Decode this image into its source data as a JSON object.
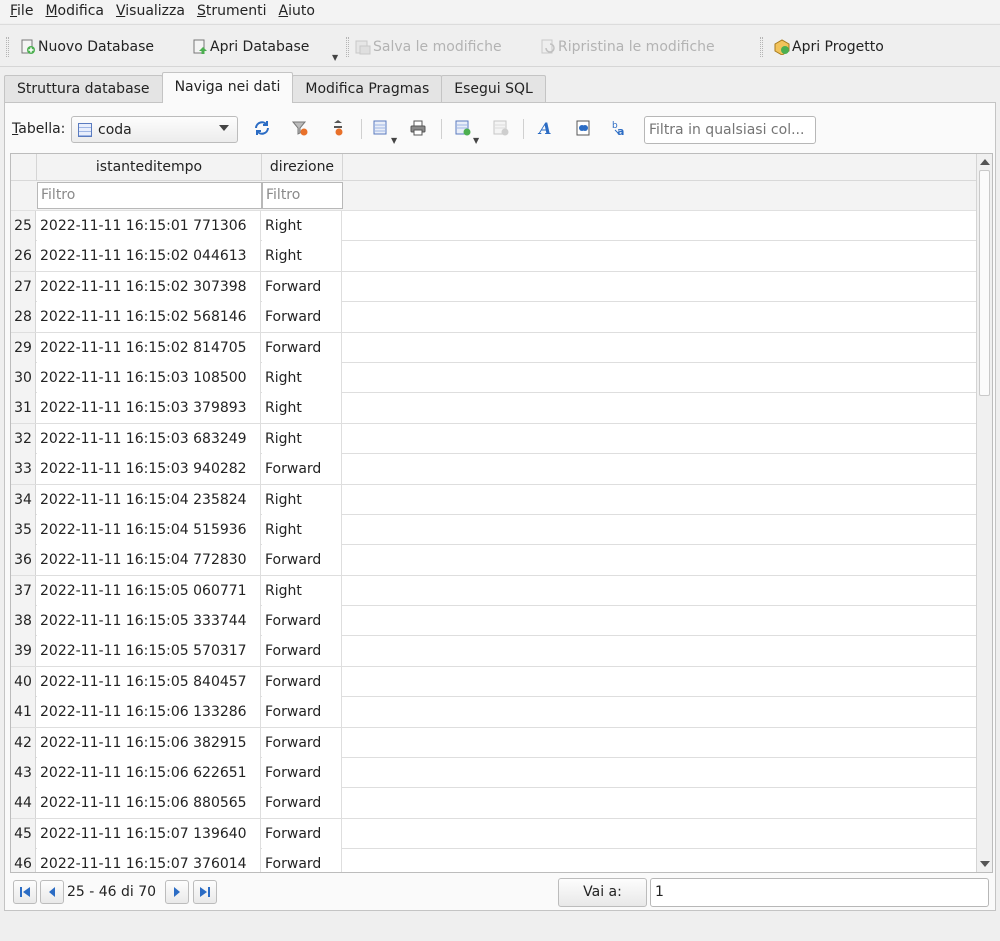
{
  "menu": [
    {
      "u": "F",
      "rest": "ile"
    },
    {
      "u": "M",
      "rest": "odifica"
    },
    {
      "u": "V",
      "rest": "isualizza"
    },
    {
      "u": "S",
      "rest": "trumenti"
    },
    {
      "u": "A",
      "rest": "iuto"
    }
  ],
  "toolbar": {
    "new_db": "Nuovo Database",
    "open_db": "Apri Database",
    "save_changes": "Salva le modifiche",
    "revert_changes": "Ripristina le modifiche",
    "open_project": "Apri Progetto"
  },
  "tabs": [
    "Struttura database",
    "Naviga nei dati",
    "Modifica Pragmas",
    "Esegui SQL"
  ],
  "active_tab": 1,
  "table_toolbar": {
    "label_u": "T",
    "label_rest": "abella:",
    "table_name": "coda",
    "filter_all_placeholder": "Filtra in qualsiasi col..."
  },
  "grid": {
    "columns": [
      "istanteditempo",
      "direzione"
    ],
    "filter_placeholder": "Filtro",
    "rows": [
      {
        "n": "25",
        "t": "2022-11-11 16:15:01 771306",
        "d": "Right"
      },
      {
        "n": "26",
        "t": "2022-11-11 16:15:02 044613",
        "d": "Right"
      },
      {
        "n": "27",
        "t": "2022-11-11 16:15:02 307398",
        "d": "Forward"
      },
      {
        "n": "28",
        "t": "2022-11-11 16:15:02 568146",
        "d": "Forward"
      },
      {
        "n": "29",
        "t": "2022-11-11 16:15:02 814705",
        "d": "Forward"
      },
      {
        "n": "30",
        "t": "2022-11-11 16:15:03 108500",
        "d": "Right"
      },
      {
        "n": "31",
        "t": "2022-11-11 16:15:03 379893",
        "d": "Right"
      },
      {
        "n": "32",
        "t": "2022-11-11 16:15:03 683249",
        "d": "Right"
      },
      {
        "n": "33",
        "t": "2022-11-11 16:15:03 940282",
        "d": "Forward"
      },
      {
        "n": "34",
        "t": "2022-11-11 16:15:04 235824",
        "d": "Right"
      },
      {
        "n": "35",
        "t": "2022-11-11 16:15:04 515936",
        "d": "Right"
      },
      {
        "n": "36",
        "t": "2022-11-11 16:15:04 772830",
        "d": "Forward"
      },
      {
        "n": "37",
        "t": "2022-11-11 16:15:05 060771",
        "d": "Right"
      },
      {
        "n": "38",
        "t": "2022-11-11 16:15:05 333744",
        "d": "Forward"
      },
      {
        "n": "39",
        "t": "2022-11-11 16:15:05 570317",
        "d": "Forward"
      },
      {
        "n": "40",
        "t": "2022-11-11 16:15:05 840457",
        "d": "Forward"
      },
      {
        "n": "41",
        "t": "2022-11-11 16:15:06 133286",
        "d": "Forward"
      },
      {
        "n": "42",
        "t": "2022-11-11 16:15:06 382915",
        "d": "Forward"
      },
      {
        "n": "43",
        "t": "2022-11-11 16:15:06 622651",
        "d": "Forward"
      },
      {
        "n": "44",
        "t": "2022-11-11 16:15:06 880565",
        "d": "Forward"
      },
      {
        "n": "45",
        "t": "2022-11-11 16:15:07 139640",
        "d": "Forward"
      },
      {
        "n": "46",
        "t": "2022-11-11 16:15:07 376014",
        "d": "Forward"
      }
    ]
  },
  "nav": {
    "range": "25 - 46 di 70",
    "goto_label": "Vai a:",
    "goto_value": "1"
  }
}
